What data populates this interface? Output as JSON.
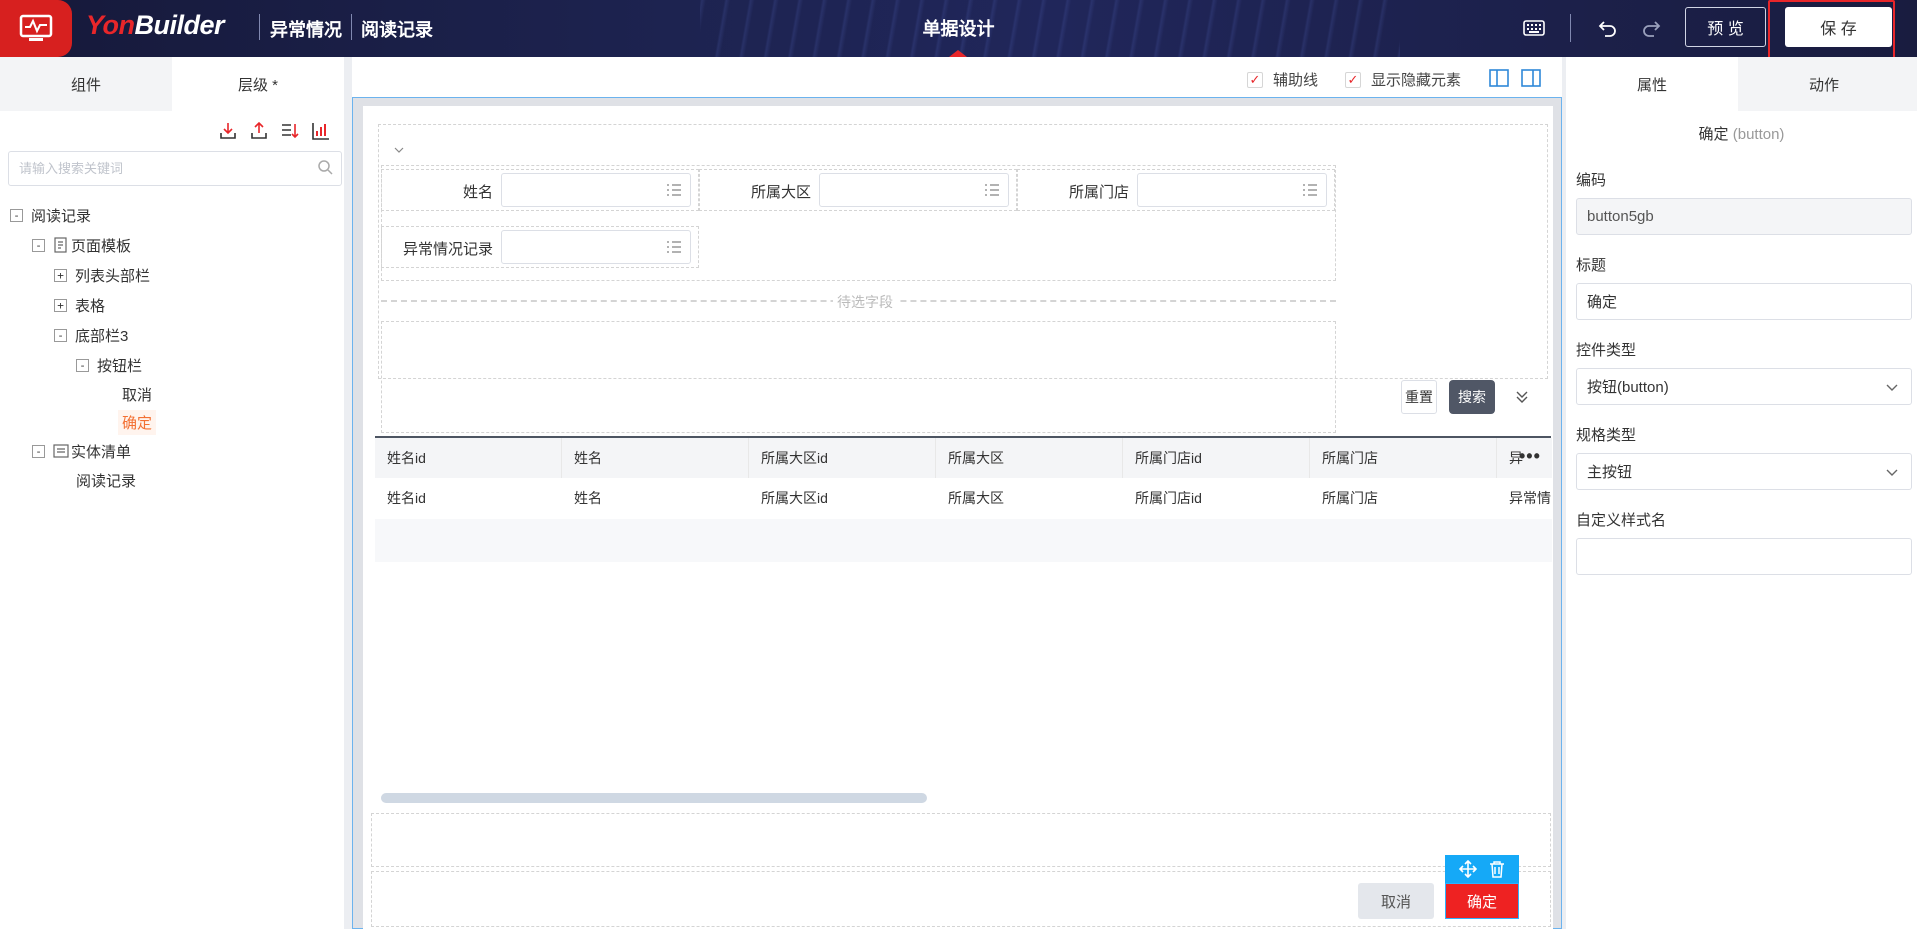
{
  "header": {
    "brand_prefix": "Yon",
    "brand_suffix": "Builder",
    "crumbs": [
      "异常情况",
      "阅读记录"
    ],
    "title": "单据设计",
    "preview_label": "预 览",
    "save_label": "保 存",
    "annotation": "保存",
    "icons": [
      "keyboard-icon",
      "undo-icon",
      "redo-icon"
    ]
  },
  "left_panel": {
    "tabs": [
      "组件",
      "层级 *"
    ],
    "active_tab": 1,
    "search_placeholder": "请输入搜索关键词",
    "tool_icons": [
      "import-icon",
      "export-icon",
      "sort-icon",
      "chart-icon"
    ],
    "tree": [
      {
        "label": "阅读记录",
        "toggle": "-"
      },
      {
        "label": "页面模板",
        "toggle": "-",
        "icon": "template-icon"
      },
      {
        "label": "列表头部栏",
        "toggle": "+"
      },
      {
        "label": "表格",
        "toggle": "+"
      },
      {
        "label": "底部栏3",
        "toggle": "-"
      },
      {
        "label": "按钮栏",
        "toggle": "-"
      },
      {
        "label": "取消"
      },
      {
        "label": "确定",
        "selected": true
      },
      {
        "label": "实体清单",
        "toggle": "-",
        "icon": "entity-icon"
      },
      {
        "label": "阅读记录"
      }
    ]
  },
  "canvas": {
    "options": [
      "辅助线",
      "显示隐藏元素"
    ],
    "filter_fields": [
      "姓名",
      "所属大区",
      "所属门店",
      "异常情况记录"
    ],
    "pending_label": "待选字段",
    "reset_label": "重置",
    "search_label": "搜索",
    "table_headers": [
      "姓名id",
      "姓名",
      "所属大区id",
      "所属大区",
      "所属门店id",
      "所属门店",
      "异"
    ],
    "table_row": [
      "姓名id",
      "姓名",
      "所属大区id",
      "所属大区",
      "所属门店id",
      "所属门店",
      "异常情"
    ],
    "more_label": "•••",
    "footer_cancel": "取消",
    "footer_confirm": "确定"
  },
  "right_panel": {
    "tabs": [
      "属性",
      "动作"
    ],
    "active_tab": 0,
    "component_name": "确定",
    "component_type": "(button)",
    "fields": [
      {
        "label": "编码",
        "value": "button5gb",
        "readonly": true
      },
      {
        "label": "标题",
        "value": "确定"
      },
      {
        "label": "控件类型",
        "value": "按钮(button)",
        "select": true
      },
      {
        "label": "规格类型",
        "value": "主按钮",
        "select": true
      },
      {
        "label": "自定义样式名",
        "value": ""
      }
    ]
  },
  "colors": {
    "brand_red": "#e8262a",
    "header_bg": "#1d2350",
    "selection_blue": "#15a9f7",
    "confirm_red": "#ee2222"
  }
}
